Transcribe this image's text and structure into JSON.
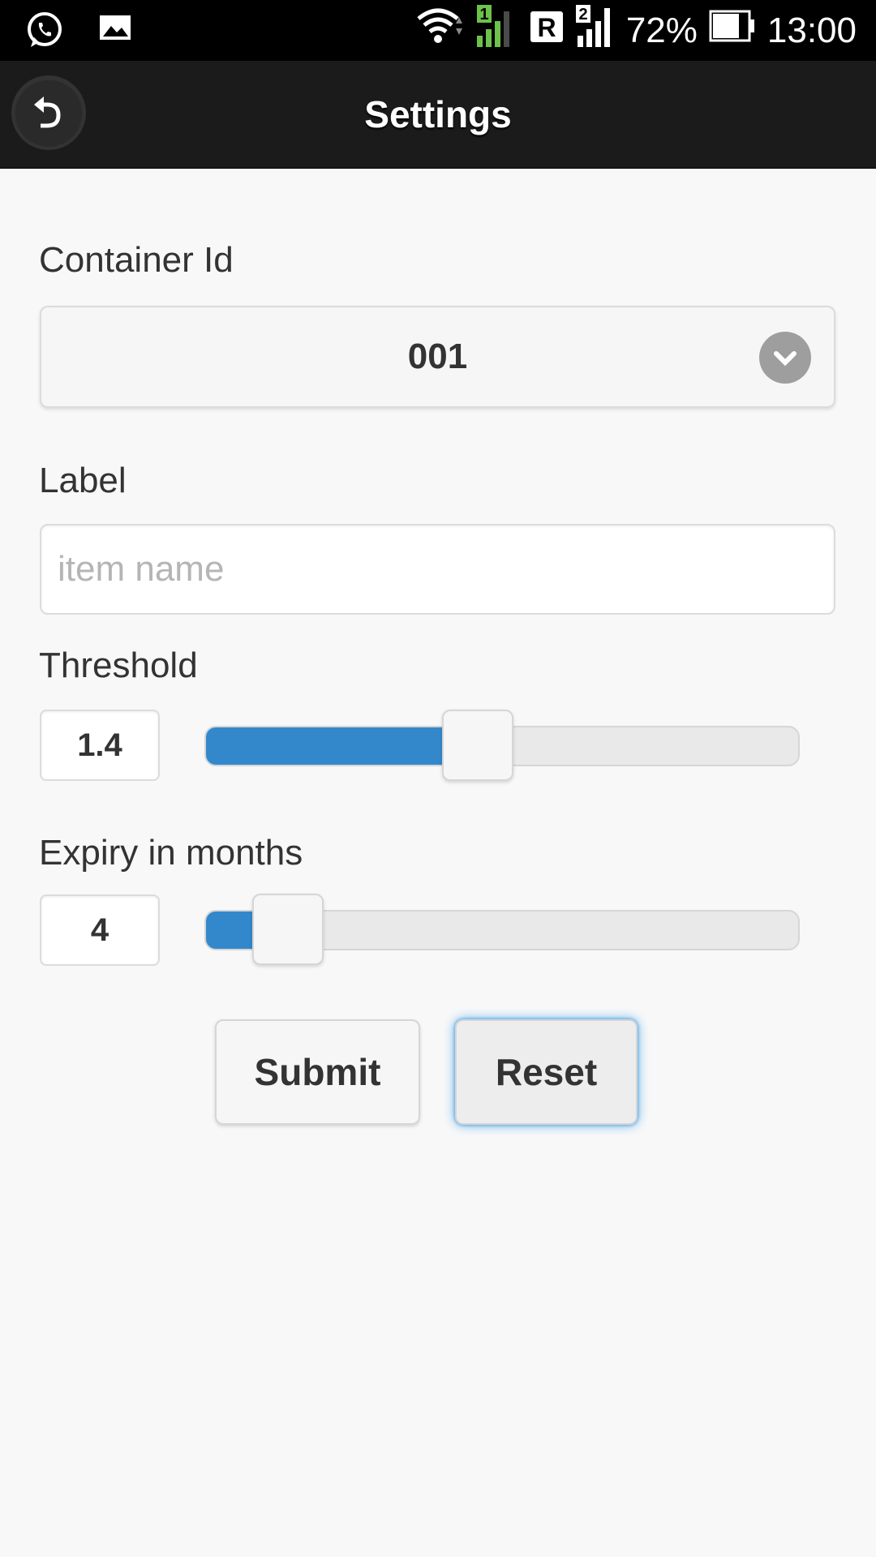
{
  "status_bar": {
    "battery": "72%",
    "time": "13:00",
    "roaming": "R",
    "sim1": "1",
    "sim2": "2"
  },
  "header": {
    "title": "Settings",
    "back_icon": "undo-arrow-icon"
  },
  "form": {
    "container": {
      "label": "Container Id",
      "selected": "001"
    },
    "label_field": {
      "label": "Label",
      "value": "",
      "placeholder": "item name"
    },
    "threshold": {
      "label": "Threshold",
      "value": "1.4",
      "level": 0.45
    },
    "expiry": {
      "label": "Expiry in months",
      "value": "4",
      "level": 0.13
    }
  },
  "buttons": {
    "submit": "Submit",
    "reset": "Reset"
  },
  "colors": {
    "accent": "#3388cc",
    "header_bg": "#1b1b1b",
    "page_bg": "#f8f8f8"
  }
}
